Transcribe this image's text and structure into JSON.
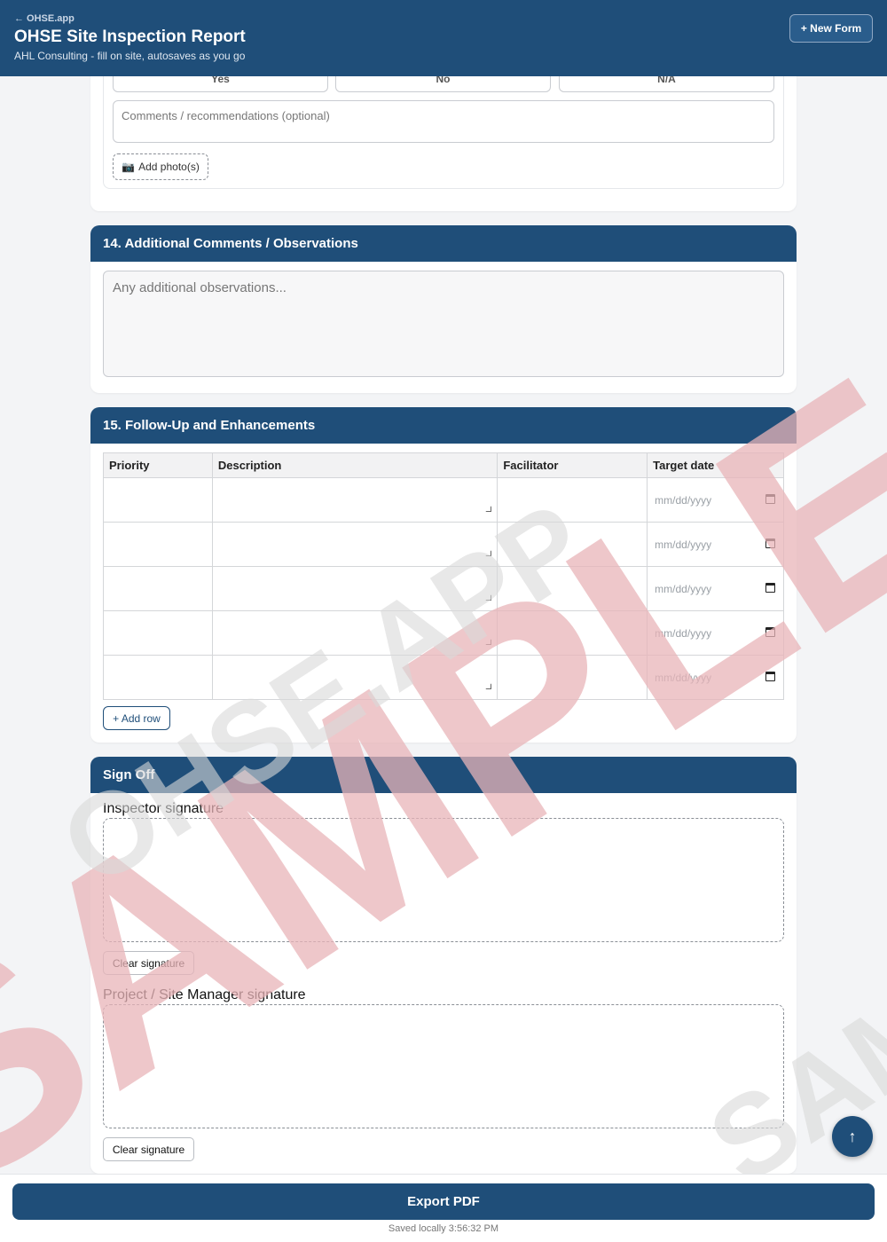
{
  "header": {
    "back_link": "← OHSE.app",
    "title": "OHSE Site Inspection Report",
    "subtitle": "AHL Consulting - fill on site, autosaves as you go",
    "new_form_label": "+ New Form"
  },
  "section13": {
    "options": [
      "Yes",
      "No",
      "N/A"
    ],
    "comments_placeholder": "Comments / recommendations (optional)",
    "add_photo_label": "Add photo(s)",
    "add_photo_icon": "camera-icon"
  },
  "section14": {
    "title": "14. Additional Comments / Observations",
    "placeholder": "Any additional observations..."
  },
  "section15": {
    "title": "15. Follow-Up and Enhancements",
    "columns": [
      "Priority",
      "Description",
      "Facilitator",
      "Target date"
    ],
    "rows": [
      {
        "priority": "",
        "description": "",
        "facilitator": "",
        "target_date_placeholder": "mm/dd/yyyy"
      },
      {
        "priority": "",
        "description": "",
        "facilitator": "",
        "target_date_placeholder": "mm/dd/yyyy"
      },
      {
        "priority": "",
        "description": "",
        "facilitator": "",
        "target_date_placeholder": "mm/dd/yyyy"
      },
      {
        "priority": "",
        "description": "",
        "facilitator": "",
        "target_date_placeholder": "mm/dd/yyyy"
      },
      {
        "priority": "",
        "description": "",
        "facilitator": "",
        "target_date_placeholder": "mm/dd/yyyy"
      }
    ],
    "add_row_label": "+ Add row"
  },
  "signoff": {
    "title": "Sign Off",
    "inspector_label": "Inspector signature",
    "manager_label": "Project / Site Manager signature",
    "clear_label": "Clear signature"
  },
  "watermark": {
    "main_text": "SAMPLE",
    "secondary_text": "OHSE.APP",
    "corner_text": "SAM",
    "main_color": "#e8b4b8",
    "secondary_color": "#d9d9d9"
  },
  "footer": {
    "export_label": "Export PDF",
    "saved_status": "Saved locally 3:56:32 PM"
  },
  "scroll_top_icon": "arrow-up-icon",
  "colors": {
    "primary": "#1f4e79",
    "background": "#f3f4f6"
  }
}
